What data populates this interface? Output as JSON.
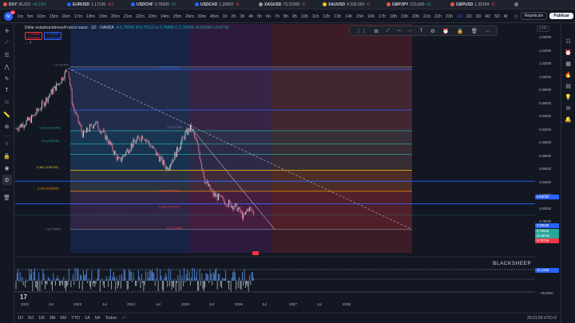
{
  "ticker": [
    {
      "sym": "DXY",
      "val": "96,622",
      "chg": "+0,13%",
      "color": "#ef5350",
      "neg": false
    },
    {
      "sym": "EURUSD",
      "val": "1,17136",
      "chg": "-0,1",
      "color": "#2962ff",
      "neg": true
    },
    {
      "sym": "USDCHF",
      "val": "0,78928",
      "chg": "+0,",
      "color": "#2962ff",
      "neg": false
    },
    {
      "sym": "USDCAD",
      "val": "1,36802",
      "chg": "-0,",
      "color": "#2962ff",
      "neg": true
    },
    {
      "sym": "XAGUSD",
      "val": "73,31900",
      "chg": "-0,",
      "color": "#9598a1",
      "neg": true
    },
    {
      "sym": "XAUUSD",
      "val": "4.336,560",
      "chg": "-0,",
      "color": "#f5c518",
      "neg": true
    },
    {
      "sym": "GBPJPY",
      "val": "215,690",
      "chg": "+0,",
      "color": "#ef5350",
      "neg": false
    },
    {
      "sym": "GBPUSD",
      "val": "1,35184",
      "chg": "-0,",
      "color": "#ef5350",
      "neg": true
    },
    {
      "sym": "",
      "val": "",
      "chg": "",
      "color": "#787b86",
      "neg": false
    }
  ],
  "toolbar": {
    "avatar": "M",
    "badge": "11",
    "timeframes": [
      "1m",
      "5m",
      "10m",
      "15m",
      "16m",
      "17m",
      "18m",
      "19m",
      "20m",
      "21m",
      "22m",
      "23m",
      "24m",
      "25m",
      "26m",
      "30m",
      "45m",
      "1h",
      "2h",
      "3h",
      "4h",
      "5h",
      "6h",
      "7h",
      "8h",
      "9h",
      "10h",
      "11h",
      "12h",
      "13h",
      "14h",
      "15h",
      "16h",
      "17h",
      "18h",
      "19h",
      "20h",
      "21h",
      "22h",
      "23h",
      "1D",
      "2D",
      "3D",
      "4D",
      "5D",
      "M"
    ],
    "active_timeframe": "1D",
    "replay": "Repetición",
    "publish": "Publicar"
  },
  "legend": {
    "title": "Dólar estadounidense/Franco suizo · 1D · OANDA",
    "ohlc": "A 0,78546  M 0,79113  m 0,78485  C 0,78928 +0,00368 (+0,47%)",
    "bid": "0,78928",
    "bid_label": "VENDER",
    "ask": "0,78938",
    "ask_label": "COMPRAR",
    "collapse": "4"
  },
  "price_scale": {
    "currency": "CHF",
    "labels": [
      "1,06000",
      "1,04000",
      "1,02000",
      "1,00000",
      "0,98000",
      "0,96000",
      "0,94000",
      "0,92000",
      "0,90000",
      "0,88000",
      "0,86000",
      "0,84000",
      "0,82000",
      "0,80000",
      "0,78000"
    ],
    "badges": [
      {
        "text": "0,84039",
        "color": "#2962ff"
      },
      {
        "text": "0,80598",
        "color": "#2962ff"
      },
      {
        "text": "0,78928",
        "color": "#26a69a"
      },
      {
        "text": "02:38:54",
        "color": "#26a69a"
      },
      {
        "text": "0,78726",
        "color": "#f23645"
      }
    ],
    "osc_badge": "15,1286",
    "osc_zero": "−20,0000",
    "osc_badge_color": "#2962ff"
  },
  "fib": [
    {
      "label": "1 (1,01405)",
      "color": "#787b86"
    },
    {
      "label": "0,618 (0,91746)",
      "color": "#26a69a"
    },
    {
      "label": "0,5 (0,89735)",
      "color": "#26a69a"
    },
    {
      "label": "0,382 (0,85725)",
      "color": "#f5c518"
    },
    {
      "label": "0,236 (0,82536)",
      "color": "#ff9800"
    },
    {
      "label": "0 (0,76681)",
      "color": "#787b86"
    },
    {
      "label": "1,618 (1,01015)",
      "color": "#2962ff"
    },
    {
      "label": "1 (0,91764)",
      "color": "#787b86"
    },
    {
      "label": "0,382 (0,82113)",
      "color": "#f23645"
    },
    {
      "label": "0,236 (0,79767)",
      "color": "#f23645"
    },
    {
      "label": "0 (0,77680)",
      "color": "#f23645"
    }
  ],
  "indicator": {
    "title": "BLACKSHEEP"
  },
  "time_axis": [
    "2022",
    "Jul",
    "2023",
    "Jul",
    "2024",
    "Jul",
    "2025",
    "Jul",
    "2026",
    "Jul",
    "2027",
    "Jul",
    "2028"
  ],
  "ranges": [
    "1D",
    "5D",
    "1M",
    "3M",
    "6M",
    "YTD",
    "1A",
    "5A",
    "Todos"
  ],
  "clock": "20:21:55 UTC+2",
  "logo": "17"
}
